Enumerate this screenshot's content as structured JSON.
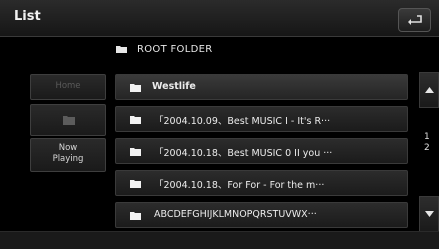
{
  "header": {
    "title": "List"
  },
  "root_folder": {
    "label": "ROOT FOLDER"
  },
  "side_buttons": {
    "home": "Home",
    "now_playing_line1": "Now",
    "now_playing_line2": "Playing"
  },
  "list": {
    "items": [
      {
        "label": "Westlife"
      },
      {
        "label": "「2004.10.09、Best MUSIC I - It's R···"
      },
      {
        "label": "「2004.10.18、Best MUSIC 0 II you ···"
      },
      {
        "label": "「2004.10.18、For For - For the m···"
      },
      {
        "label": "ABCDEFGHIJKLMNOPQRSTUVWX···"
      }
    ]
  },
  "pager": {
    "current": "1",
    "total": "2"
  },
  "colors": {
    "background": "#000000",
    "row": "#222222",
    "text": "#ffffff"
  }
}
